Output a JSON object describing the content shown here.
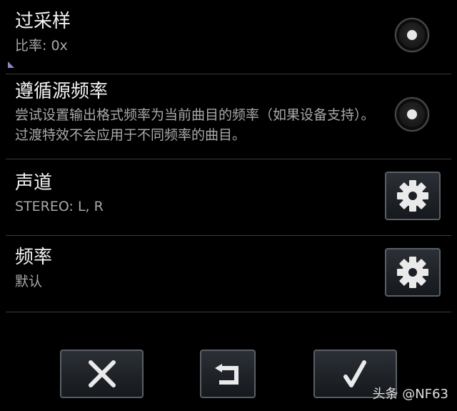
{
  "settings": [
    {
      "title": "过采样",
      "summary": "比率: 0x",
      "control": "radio"
    },
    {
      "title": "遵循源频率",
      "summary": "尝试设置输出格式频率为当前曲目的频率（如果设备支持）。过渡特效不会应用于不同频率的曲目。",
      "control": "radio"
    },
    {
      "title": "声道",
      "summary": "STEREO: L, R",
      "control": "gear"
    },
    {
      "title": "频率",
      "summary": "默认",
      "control": "gear"
    }
  ],
  "icons": {
    "settings_button": "gear-icon",
    "cancel": "close-icon",
    "reset": "undo-icon",
    "confirm": "check-icon"
  },
  "watermark": "头条 @NF63",
  "colors": {
    "background": "#000000",
    "title": "#f2f2f2",
    "summary": "#a9a9a9",
    "button_border": "#5a5f66"
  }
}
